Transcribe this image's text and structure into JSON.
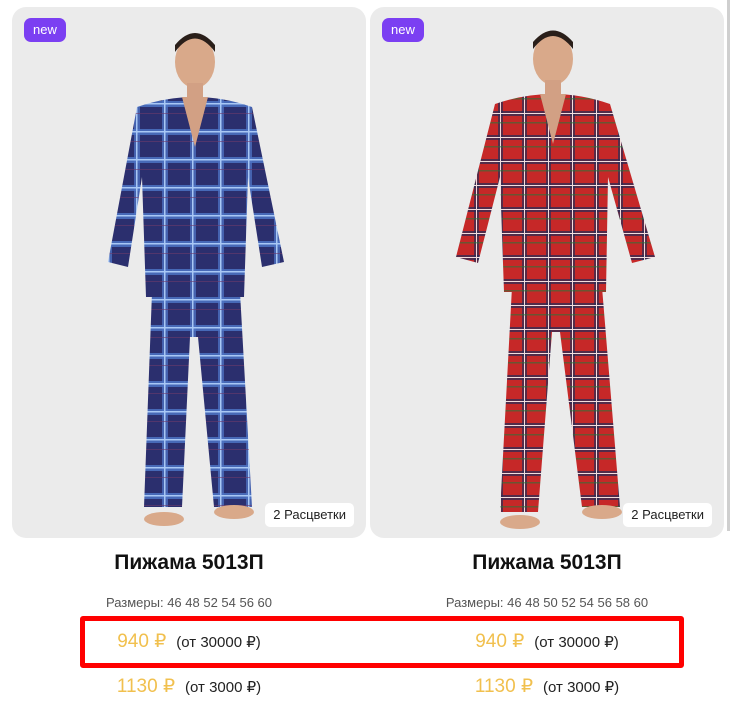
{
  "products": [
    {
      "badge": "new",
      "colors_label": "2 Расцветки",
      "title": "Пижама 5013П",
      "sizes": "Размеры: 46 48 52 54 56 60",
      "prices": [
        {
          "price": "940 ₽",
          "condition": "(от 30000 ₽)"
        },
        {
          "price": "1130 ₽",
          "condition": "(от 3000 ₽)"
        }
      ],
      "photo": {
        "pattern": "blue plaid",
        "base": "#2b2f6e",
        "check": "#5f8fd9",
        "accent": "#8fb6f0"
      }
    },
    {
      "badge": "new",
      "colors_label": "2 Расцветки",
      "title": "Пижама 5013П",
      "sizes": "Размеры: 46 48 50 52 54 56 58 60",
      "prices": [
        {
          "price": "940 ₽",
          "condition": "(от 30000 ₽)"
        },
        {
          "price": "1130 ₽",
          "condition": "(от 3000 ₽)"
        }
      ],
      "photo": {
        "pattern": "red plaid",
        "base": "#c62828",
        "check": "#1f2a5a",
        "accent": "#f3d9d9"
      }
    }
  ],
  "colors": {
    "badge": "#7b3ff2",
    "price": "#f1c04e",
    "highlight": "#ff0000"
  }
}
